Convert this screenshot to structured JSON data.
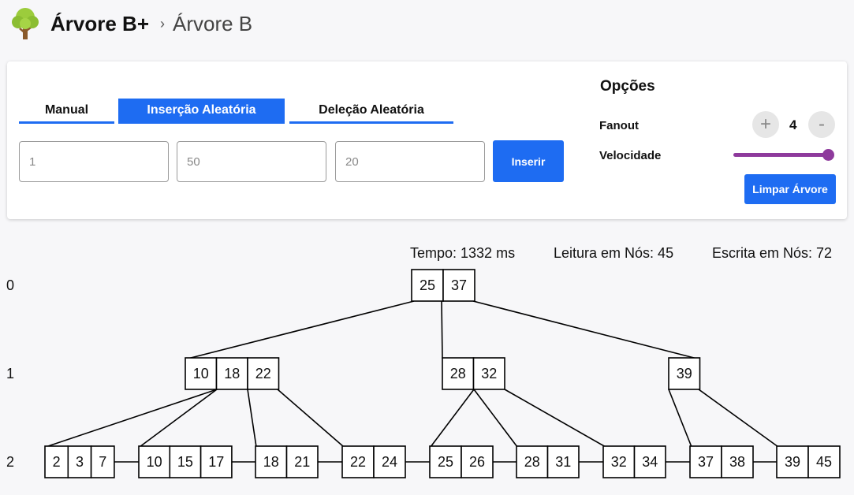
{
  "header": {
    "title": "Árvore B+",
    "breadcrumb_separator": "›",
    "breadcrumb_link": "Árvore B"
  },
  "tabs": [
    {
      "label": "Manual",
      "active": false
    },
    {
      "label": "Inserção Aleatória",
      "active": true
    },
    {
      "label": "Deleção Aleatória",
      "active": false
    }
  ],
  "inputs": [
    {
      "placeholder": "1"
    },
    {
      "placeholder": "50"
    },
    {
      "placeholder": "20"
    }
  ],
  "insert_button": "Inserir",
  "options": {
    "title": "Opções",
    "fanout_label": "Fanout",
    "fanout_value": "4",
    "plus": "+",
    "minus": "-",
    "speed_label": "Velocidade",
    "speed_value": 1.0,
    "clear_button": "Limpar Árvore"
  },
  "stats": {
    "time": "Tempo: 1332 ms",
    "reads": "Leitura em Nós: 45",
    "writes": "Escrita em Nós: 72"
  },
  "levels": [
    "0",
    "1",
    "2"
  ],
  "tree": {
    "level0": [
      [
        "25",
        "37"
      ]
    ],
    "level1": [
      [
        "10",
        "18",
        "22"
      ],
      [
        "28",
        "32"
      ],
      [
        "39"
      ]
    ],
    "level2": [
      [
        "2",
        "3",
        "7"
      ],
      [
        "10",
        "15",
        "17"
      ],
      [
        "18",
        "21"
      ],
      [
        "22",
        "24"
      ],
      [
        "25",
        "26"
      ],
      [
        "28",
        "31"
      ],
      [
        "32",
        "34"
      ],
      [
        "37",
        "38"
      ],
      [
        "39",
        "45"
      ]
    ]
  },
  "colors": {
    "accent": "#1e6cf2",
    "slider": "#8e3a9c"
  }
}
